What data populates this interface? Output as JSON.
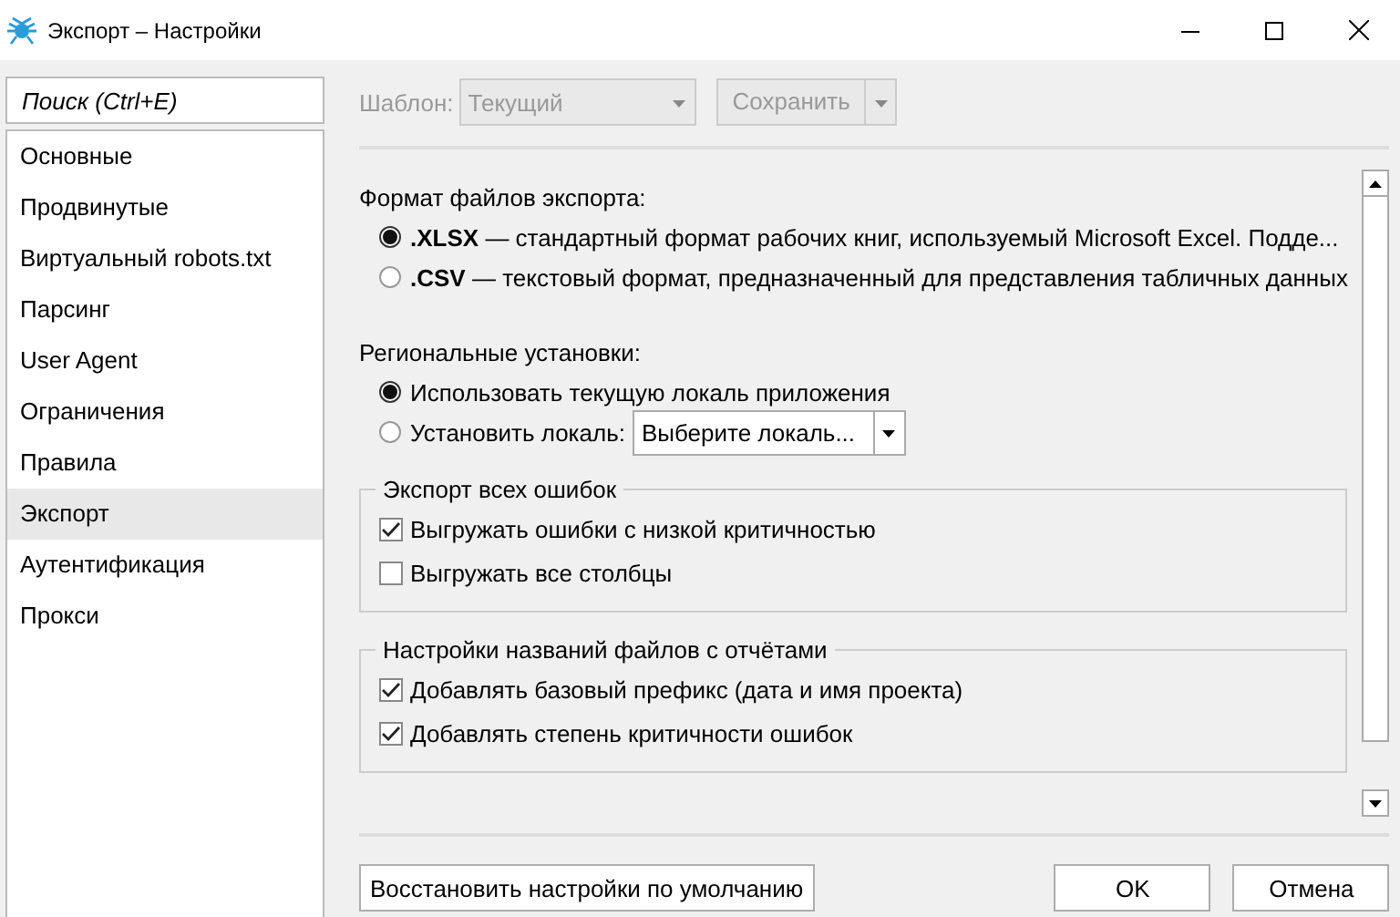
{
  "window": {
    "title": "Экспорт – Настройки"
  },
  "search": {
    "placeholder": "Поиск (Ctrl+E)"
  },
  "sidebar": {
    "items": [
      {
        "label": "Основные",
        "selected": false
      },
      {
        "label": "Продвинутые",
        "selected": false
      },
      {
        "label": "Виртуальный robots.txt",
        "selected": false
      },
      {
        "label": "Парсинг",
        "selected": false
      },
      {
        "label": "User Agent",
        "selected": false
      },
      {
        "label": "Ограничения",
        "selected": false
      },
      {
        "label": "Правила",
        "selected": false
      },
      {
        "label": "Экспорт",
        "selected": true
      },
      {
        "label": "Аутентификация",
        "selected": false
      },
      {
        "label": "Прокси",
        "selected": false
      }
    ]
  },
  "toolbar": {
    "template_label": "Шаблон:",
    "template_value": "Текущий",
    "disabled": true,
    "save_button": "Сохранить"
  },
  "sections": [
    {
      "kind": "radios",
      "label": "Формат файлов экспорта:",
      "options": [
        {
          "text": "**.XLSX** — стандартный формат рабочих книг, используемый Microsoft Excel. Подде...",
          "selected": true
        },
        {
          "text": "**.CSV** — текстовый формат, предназначенный для представления табличных данных",
          "selected": false
        }
      ]
    },
    {
      "kind": "radios",
      "label": "Региональные установки:",
      "options": [
        {
          "text": "Использовать текущую локаль приложения",
          "selected": true
        },
        {
          "text": "Установить локаль:",
          "selected": false,
          "dropdown": "Выберите локаль..."
        }
      ]
    },
    {
      "kind": "group",
      "label": "Экспорт всех ошибок",
      "options": [
        {
          "text": "Выгружать ошибки с низкой критичностью",
          "checked": true
        },
        {
          "text": "Выгружать все столбцы",
          "checked": false
        }
      ]
    },
    {
      "kind": "group",
      "label": "Настройки названий файлов с отчётами",
      "options": [
        {
          "text": "Добавлять базовый префикс (дата и имя проекта)",
          "checked": true
        },
        {
          "text": "Добавлять степень критичности ошибок",
          "checked": true
        }
      ]
    }
  ],
  "footer": {
    "reset_button": "Восстановить настройки по умолчанию",
    "ok_button": "OK",
    "cancel_button": "Отмена"
  }
}
